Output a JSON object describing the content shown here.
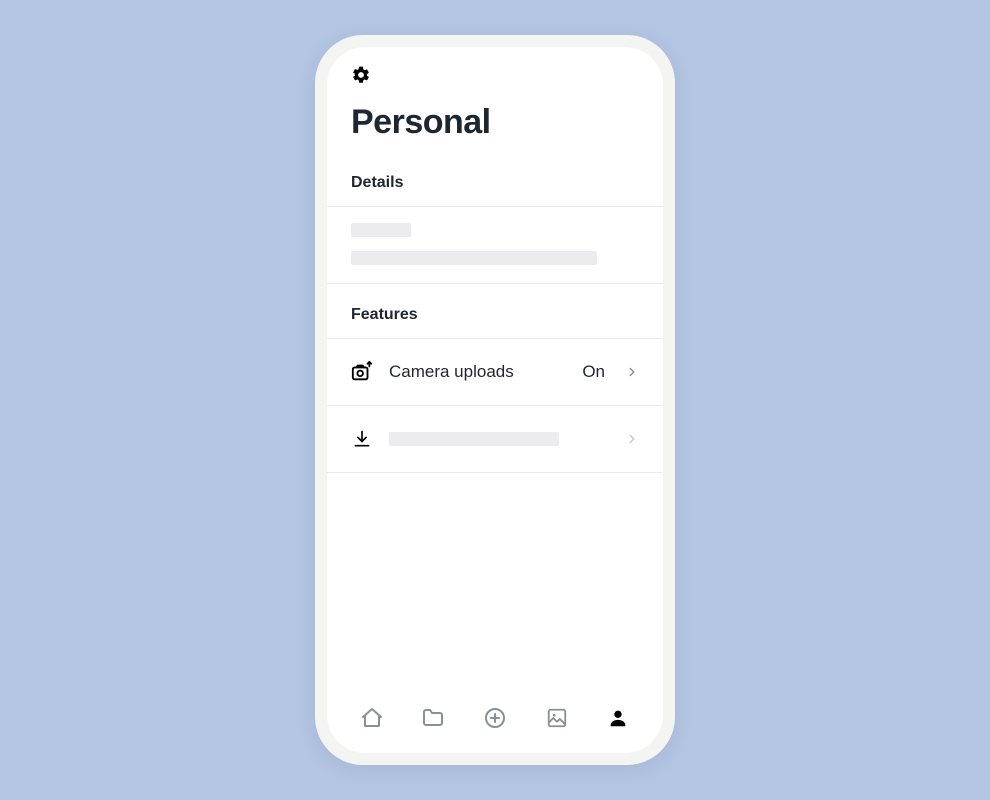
{
  "page": {
    "title": "Personal"
  },
  "sections": {
    "details": {
      "heading": "Details"
    },
    "features": {
      "heading": "Features",
      "camera_uploads": {
        "label": "Camera uploads",
        "value": "On"
      }
    }
  }
}
